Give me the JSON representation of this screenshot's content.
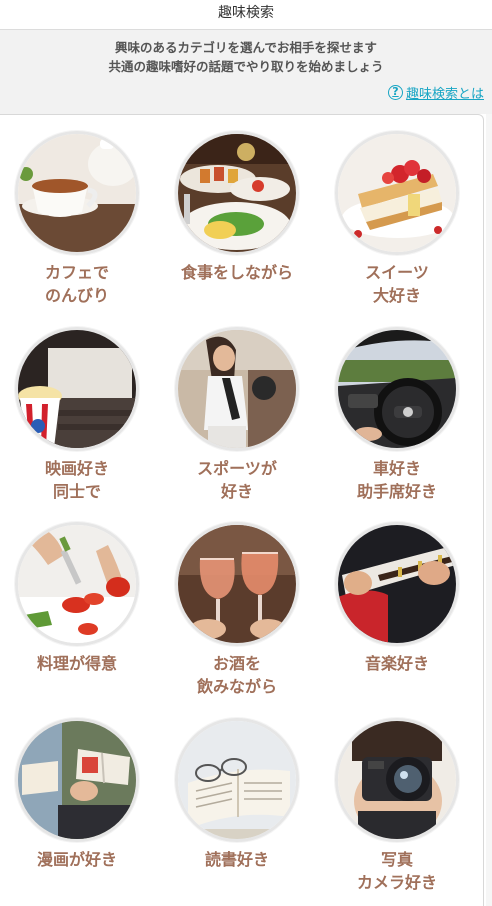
{
  "header": {
    "title": "趣味検索"
  },
  "intro": {
    "line1": "興味のあるカテゴリを選んでお相手を探せます",
    "line2": "共通の趣味嗜好の話題でやり取りを始めましょう",
    "help_icon": "question-circle-icon",
    "help_link": "趣味検索とは"
  },
  "colors": {
    "label": "#a0705a",
    "link": "#18a5c4",
    "intro_bg": "#f2f2f2"
  },
  "categories": [
    {
      "line1": "カフェで",
      "line2": "のんびり",
      "image": "tea-cup-photo"
    },
    {
      "line1": "食事をしながら",
      "line2": "",
      "image": "dinner-plates-photo"
    },
    {
      "line1": "スイーツ",
      "line2": "大好き",
      "image": "strawberry-pastry-photo"
    },
    {
      "line1": "映画好き",
      "line2": "同士で",
      "image": "cinema-popcorn-photo"
    },
    {
      "line1": "スポーツが",
      "line2": "好き",
      "image": "woman-with-ball-photo"
    },
    {
      "line1": "車好き",
      "line2": "助手席好き",
      "image": "car-steering-wheel-photo"
    },
    {
      "line1": "料理が得意",
      "line2": "",
      "image": "chopping-peppers-photo"
    },
    {
      "line1": "お酒を",
      "line2": "飲みながら",
      "image": "wine-glasses-photo"
    },
    {
      "line1": "音楽好き",
      "line2": "",
      "image": "electric-guitar-photo"
    },
    {
      "line1": "漫画が好き",
      "line2": "",
      "image": "reading-manga-photo"
    },
    {
      "line1": "読書好き",
      "line2": "",
      "image": "open-book-glasses-photo"
    },
    {
      "line1": "写真",
      "line2": "カメラ好き",
      "image": "camera-photographer-photo"
    }
  ]
}
